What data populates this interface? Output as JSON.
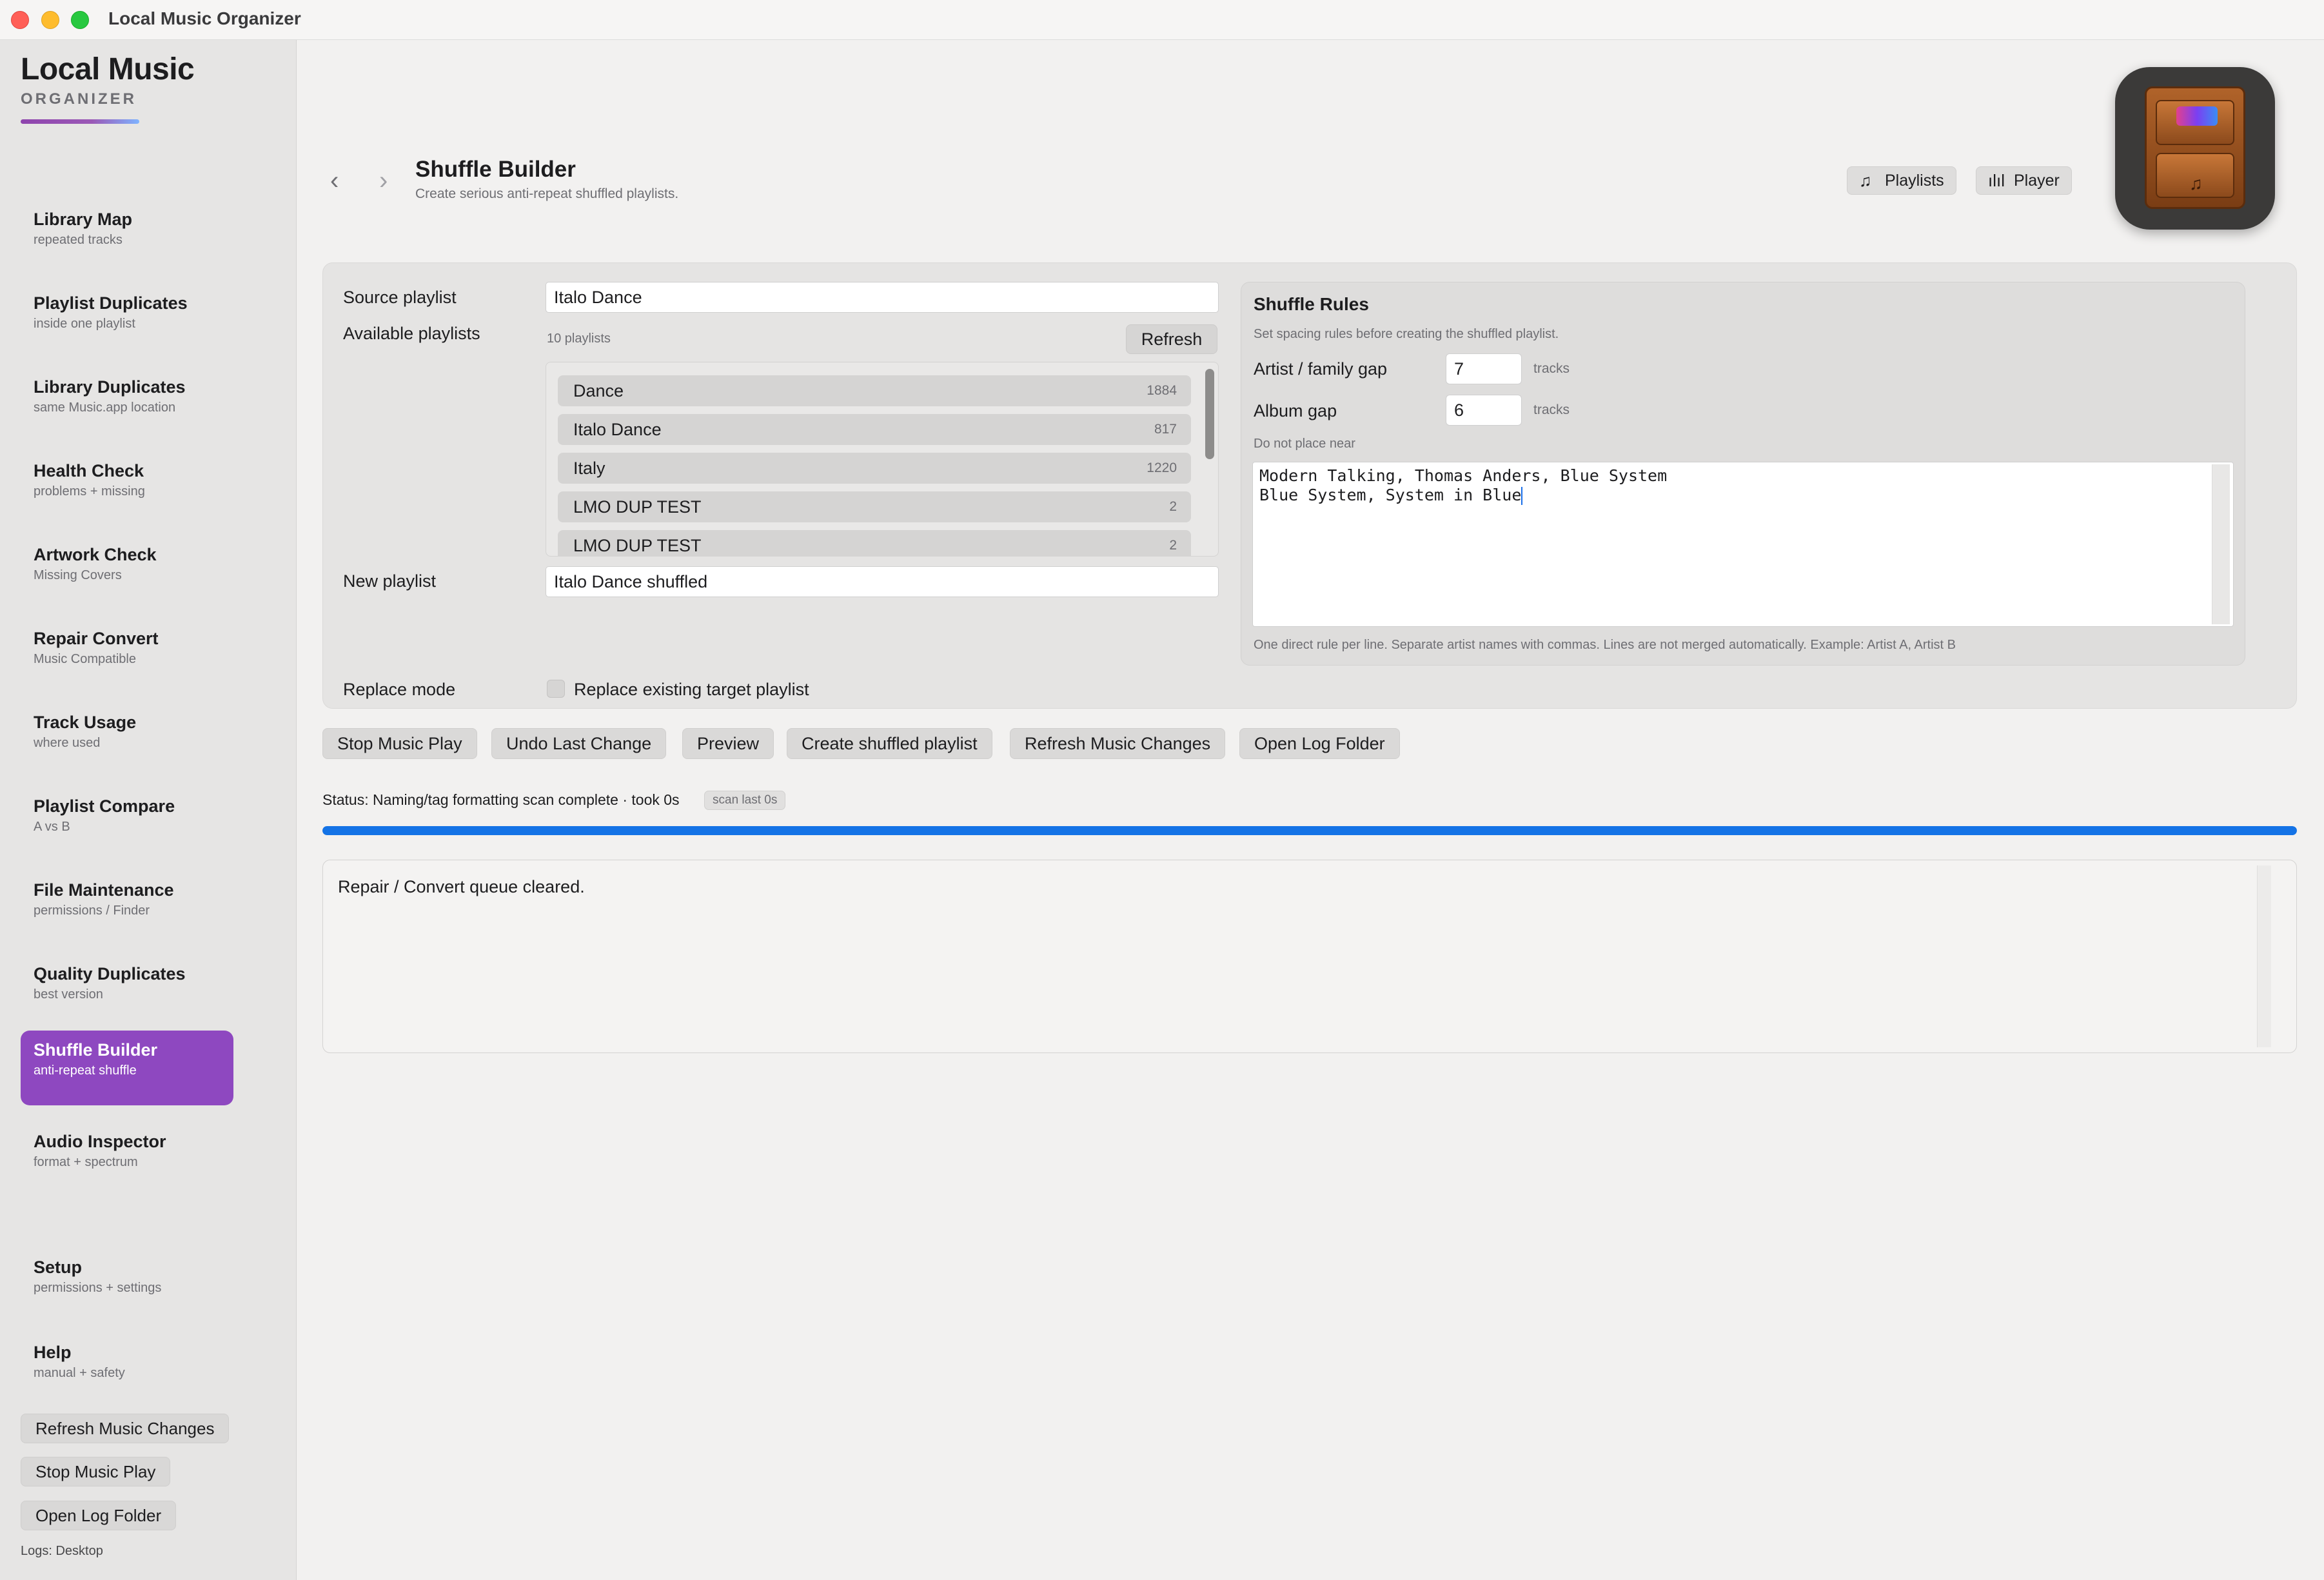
{
  "window": {
    "title": "Local Music Organizer"
  },
  "brand": {
    "title": "Local Music",
    "subtitle": "ORGANIZER"
  },
  "sidebar": {
    "items": [
      {
        "label": "Library Map",
        "sub": "repeated tracks"
      },
      {
        "label": "Playlist Duplicates",
        "sub": "inside one playlist"
      },
      {
        "label": "Library Duplicates",
        "sub": "same Music.app location"
      },
      {
        "label": "Health Check",
        "sub": "problems + missing"
      },
      {
        "label": "Artwork Check",
        "sub": "Missing Covers"
      },
      {
        "label": "Repair Convert",
        "sub": "Music Compatible"
      },
      {
        "label": "Track Usage",
        "sub": "where used"
      },
      {
        "label": "Playlist Compare",
        "sub": "A vs B"
      },
      {
        "label": "File Maintenance",
        "sub": "permissions / Finder"
      },
      {
        "label": "Quality Duplicates",
        "sub": "best version"
      },
      {
        "label": "Shuffle Builder",
        "sub": "anti-repeat shuffle",
        "active": true
      },
      {
        "label": "Audio Inspector",
        "sub": "format + spectrum"
      },
      {
        "label": "Setup",
        "sub": "permissions + settings"
      },
      {
        "label": "Help",
        "sub": "manual + safety"
      }
    ],
    "buttons": {
      "refresh": "Refresh Music Changes",
      "stop": "Stop Music Play",
      "open_log": "Open Log Folder"
    },
    "logs_label": "Logs: Desktop"
  },
  "header": {
    "title": "Shuffle Builder",
    "subtitle": "Create serious anti-repeat shuffled playlists.",
    "back_icon": "chevron-left-icon",
    "forward_icon": "chevron-right-icon",
    "playlists_btn": "Playlists",
    "player_btn": "Player"
  },
  "form": {
    "source_label": "Source playlist",
    "source_value": "Italo Dance",
    "available_label": "Available playlists",
    "available_count": "10 playlists",
    "refresh_btn": "Refresh",
    "playlists": [
      {
        "name": "Dance",
        "count": "1884"
      },
      {
        "name": "Italo Dance",
        "count": "817"
      },
      {
        "name": "Italy",
        "count": "1220"
      },
      {
        "name": "LMO DUP TEST",
        "count": "2"
      },
      {
        "name": "LMO DUP TEST",
        "count": "2"
      }
    ],
    "new_label": "New playlist",
    "new_value": "Italo Dance shuffled",
    "replace_label": "Replace mode",
    "replace_checkbox": "Replace existing target playlist",
    "replace_checked": false
  },
  "rules": {
    "title": "Shuffle Rules",
    "subtitle": "Set spacing rules before creating the shuffled playlist.",
    "artist_gap_label": "Artist / family gap",
    "artist_gap_value": "7",
    "album_gap_label": "Album gap",
    "album_gap_value": "6",
    "unit": "tracks",
    "near_label": "Do not place near",
    "near_lines": "Modern Talking, Thomas Anders, Blue System\nBlue System, System in Blue",
    "hint": "One direct rule per line. Separate artist names with commas. Lines are not merged automatically. Example: Artist A, Artist B"
  },
  "actions": {
    "stop": "Stop Music Play",
    "undo": "Undo Last Change",
    "preview": "Preview",
    "create": "Create shuffled playlist",
    "refresh": "Refresh Music Changes",
    "open_log": "Open Log Folder"
  },
  "status": {
    "text": "Status: Naming/tag formatting scan complete · took 0s",
    "badge": "scan last 0s",
    "progress": 1.0
  },
  "log": {
    "text": "Repair / Convert queue cleared."
  },
  "colors": {
    "accent": "#8e48c0",
    "progress": "#1473e6"
  }
}
